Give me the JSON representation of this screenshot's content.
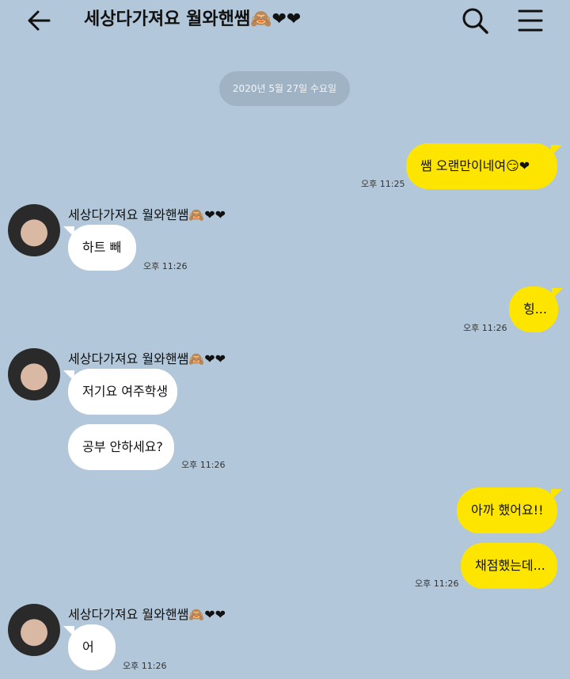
{
  "header": {
    "title": "세상다가져요 월와핸쌤",
    "title_emoji": "🙈❤❤",
    "icons": [
      "back-arrow-icon",
      "search-icon",
      "menu-icon"
    ]
  },
  "date_divider": "2020년 5월 27일 수요일",
  "colors": {
    "background": "#b2c7d9",
    "mine": "#fee500",
    "theirs": "#ffffff"
  },
  "messages": [
    {
      "from": "me",
      "text": "쌤 오랜만이네여😏❤",
      "time": "오후 11:25"
    },
    {
      "from": "them",
      "sender": "세상다가져요 월와핸쌤🙈❤❤",
      "text": "하트 빼",
      "time": "오후 11:26"
    },
    {
      "from": "me",
      "text": "힝...",
      "time": "오후 11:26"
    },
    {
      "from": "them",
      "sender": "세상다가져요 월와핸쌤🙈❤❤",
      "texts": [
        "저기요 여주학생",
        "공부 안하세요?"
      ],
      "time": "오후 11:26"
    },
    {
      "from": "me",
      "texts": [
        "아까 했어요!!",
        "채점했는데..."
      ],
      "time": "오후 11:26"
    },
    {
      "from": "them",
      "sender": "세상다가져요 월와핸쌤🙈❤❤",
      "text": "어",
      "time": "오후 11:26"
    }
  ]
}
